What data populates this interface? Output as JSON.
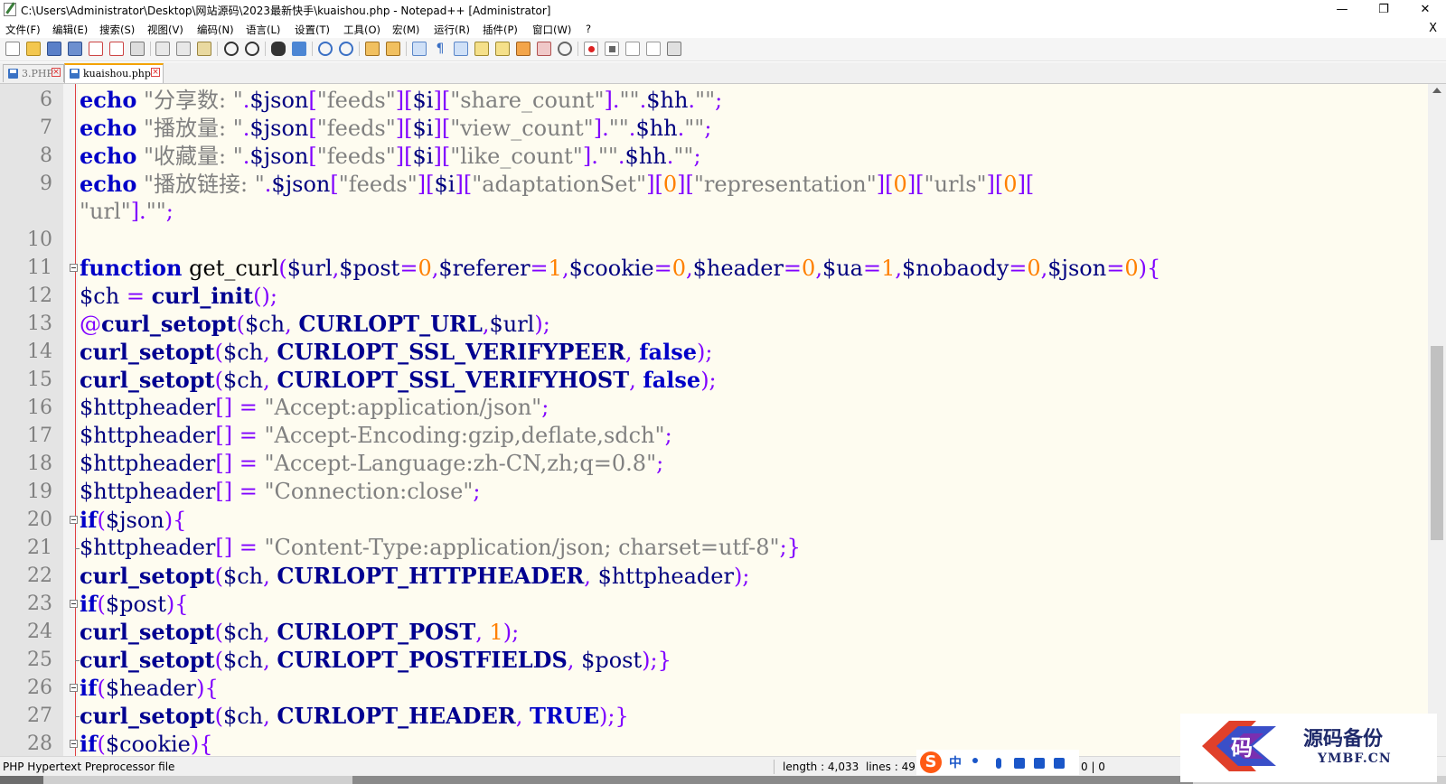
{
  "window": {
    "title": "C:\\Users\\Administrator\\Desktop\\网站源码\\2023最新快手\\kuaishou.php - Notepad++ [Administrator]",
    "minimize": "—",
    "restore": "❐",
    "close": "✕"
  },
  "menu": {
    "items": [
      "文件(F)",
      "编辑(E)",
      "搜索(S)",
      "视图(V)",
      "编码(N)",
      "语言(L)",
      "设置(T)",
      "工具(O)",
      "宏(M)",
      "运行(R)",
      "插件(P)",
      "窗口(W)",
      "?"
    ],
    "close_doc": "X"
  },
  "tabs": [
    {
      "label": "3.PHP",
      "active": false
    },
    {
      "label": "kuaishou.php",
      "active": true
    }
  ],
  "editor": {
    "lines": [
      {
        "n": "6",
        "html": "<span class=\"kw\">echo</span> <span class=\"str\">\"分享数: \"</span><span class=\"op\">.</span><span class=\"var\">$json</span><span class=\"op\">[</span><span class=\"str\">\"feeds\"</span><span class=\"op\">][</span><span class=\"var\">$i</span><span class=\"op\">][</span><span class=\"str\">\"share_count\"</span><span class=\"op\">].</span><span class=\"str\">\"\"</span><span class=\"op\">.</span><span class=\"var\">$hh</span><span class=\"op\">.</span><span class=\"str\">\"\"</span><span class=\"op\">;</span>"
      },
      {
        "n": "7",
        "html": "<span class=\"kw\">echo</span> <span class=\"str\">\"播放量: \"</span><span class=\"op\">.</span><span class=\"var\">$json</span><span class=\"op\">[</span><span class=\"str\">\"feeds\"</span><span class=\"op\">][</span><span class=\"var\">$i</span><span class=\"op\">][</span><span class=\"str\">\"view_count\"</span><span class=\"op\">].</span><span class=\"str\">\"\"</span><span class=\"op\">.</span><span class=\"var\">$hh</span><span class=\"op\">.</span><span class=\"str\">\"\"</span><span class=\"op\">;</span>"
      },
      {
        "n": "8",
        "html": "<span class=\"kw\">echo</span> <span class=\"str\">\"收藏量: \"</span><span class=\"op\">.</span><span class=\"var\">$json</span><span class=\"op\">[</span><span class=\"str\">\"feeds\"</span><span class=\"op\">][</span><span class=\"var\">$i</span><span class=\"op\">][</span><span class=\"str\">\"like_count\"</span><span class=\"op\">].</span><span class=\"str\">\"\"</span><span class=\"op\">.</span><span class=\"var\">$hh</span><span class=\"op\">.</span><span class=\"str\">\"\"</span><span class=\"op\">;</span>"
      },
      {
        "n": "9",
        "html": "<span class=\"kw\">echo</span> <span class=\"str\">\"播放链接: \"</span><span class=\"op\">.</span><span class=\"var\">$json</span><span class=\"op\">[</span><span class=\"str\">\"feeds\"</span><span class=\"op\">][</span><span class=\"var\">$i</span><span class=\"op\">][</span><span class=\"str\">\"adaptationSet\"</span><span class=\"op\">][</span><span class=\"num\">0</span><span class=\"op\">][</span><span class=\"str\">\"representation\"</span><span class=\"op\">][</span><span class=\"num\">0</span><span class=\"op\">][</span><span class=\"str\">\"urls\"</span><span class=\"op\">][</span><span class=\"num\">0</span><span class=\"op\">][</span>"
      },
      {
        "n": "",
        "html": "<span class=\"str\">\"url\"</span><span class=\"op\">].</span><span class=\"str\">\"\"</span><span class=\"op\">;</span>"
      },
      {
        "n": "10",
        "html": ""
      },
      {
        "n": "11",
        "fold": true,
        "html": "<span class=\"kw\">function</span> get_curl<span class=\"op\">(</span><span class=\"var\">$url</span><span class=\"op\">,</span><span class=\"var\">$post</span><span class=\"op\">=</span><span class=\"num\">0</span><span class=\"op\">,</span><span class=\"var\">$referer</span><span class=\"op\">=</span><span class=\"num\">1</span><span class=\"op\">,</span><span class=\"var\">$cookie</span><span class=\"op\">=</span><span class=\"num\">0</span><span class=\"op\">,</span><span class=\"var\">$header</span><span class=\"op\">=</span><span class=\"num\">0</span><span class=\"op\">,</span><span class=\"var\">$ua</span><span class=\"op\">=</span><span class=\"num\">1</span><span class=\"op\">,</span><span class=\"var\">$nobaody</span><span class=\"op\">=</span><span class=\"num\">0</span><span class=\"op\">,</span><span class=\"var\">$json</span><span class=\"op\">=</span><span class=\"num\">0</span><span class=\"op\">){</span>"
      },
      {
        "n": "12",
        "html": "<span class=\"var\">$ch</span> <span class=\"op\">=</span> <span class=\"fn\">curl_init</span><span class=\"op\">();</span>"
      },
      {
        "n": "13",
        "html": "<span class=\"op\">@</span><span class=\"fn\">curl_setopt</span><span class=\"op\">(</span><span class=\"var\">$ch</span><span class=\"op\">,</span> <span class=\"cn\">CURLOPT_URL</span><span class=\"op\">,</span><span class=\"var\">$url</span><span class=\"op\">);</span>"
      },
      {
        "n": "14",
        "html": "<span class=\"fn\">curl_setopt</span><span class=\"op\">(</span><span class=\"var\">$ch</span><span class=\"op\">,</span> <span class=\"cn\">CURLOPT_SSL_VERIFYPEER</span><span class=\"op\">,</span> <span class=\"kw\">false</span><span class=\"op\">);</span>"
      },
      {
        "n": "15",
        "html": "<span class=\"fn\">curl_setopt</span><span class=\"op\">(</span><span class=\"var\">$ch</span><span class=\"op\">,</span> <span class=\"cn\">CURLOPT_SSL_VERIFYHOST</span><span class=\"op\">,</span> <span class=\"kw\">false</span><span class=\"op\">);</span>"
      },
      {
        "n": "16",
        "html": "<span class=\"var\">$httpheader</span><span class=\"op\">[]</span> <span class=\"op\">=</span> <span class=\"str\">\"Accept:application/json\"</span><span class=\"op\">;</span>"
      },
      {
        "n": "17",
        "html": "<span class=\"var\">$httpheader</span><span class=\"op\">[]</span> <span class=\"op\">=</span> <span class=\"str\">\"Accept-Encoding:gzip,deflate,sdch\"</span><span class=\"op\">;</span>"
      },
      {
        "n": "18",
        "html": "<span class=\"var\">$httpheader</span><span class=\"op\">[]</span> <span class=\"op\">=</span> <span class=\"str\">\"Accept-Language:zh-CN,zh;q=0.8\"</span><span class=\"op\">;</span>"
      },
      {
        "n": "19",
        "html": "<span class=\"var\">$httpheader</span><span class=\"op\">[]</span> <span class=\"op\">=</span> <span class=\"str\">\"Connection:close\"</span><span class=\"op\">;</span>"
      },
      {
        "n": "20",
        "fold": true,
        "html": "<span class=\"kw\">if</span><span class=\"op\">(</span><span class=\"var\">$json</span><span class=\"op\">){</span>"
      },
      {
        "n": "21",
        "tick": true,
        "html": "<span class=\"var\">$httpheader</span><span class=\"op\">[]</span> <span class=\"op\">=</span> <span class=\"str\">\"Content-Type:application/json; charset=utf-8\"</span><span class=\"op\">;}</span>"
      },
      {
        "n": "22",
        "html": "<span class=\"fn\">curl_setopt</span><span class=\"op\">(</span><span class=\"var\">$ch</span><span class=\"op\">,</span> <span class=\"cn\">CURLOPT_HTTPHEADER</span><span class=\"op\">,</span> <span class=\"var\">$httpheader</span><span class=\"op\">);</span>"
      },
      {
        "n": "23",
        "fold": true,
        "html": "<span class=\"kw\">if</span><span class=\"op\">(</span><span class=\"var\">$post</span><span class=\"op\">){</span>"
      },
      {
        "n": "24",
        "html": "<span class=\"fn\">curl_setopt</span><span class=\"op\">(</span><span class=\"var\">$ch</span><span class=\"op\">,</span> <span class=\"cn\">CURLOPT_POST</span><span class=\"op\">,</span> <span class=\"num\">1</span><span class=\"op\">);</span>"
      },
      {
        "n": "25",
        "tick": true,
        "html": "<span class=\"fn\">curl_setopt</span><span class=\"op\">(</span><span class=\"var\">$ch</span><span class=\"op\">,</span> <span class=\"cn\">CURLOPT_POSTFIELDS</span><span class=\"op\">,</span> <span class=\"var\">$post</span><span class=\"op\">);}</span>"
      },
      {
        "n": "26",
        "fold": true,
        "html": "<span class=\"kw\">if</span><span class=\"op\">(</span><span class=\"var\">$header</span><span class=\"op\">){</span>"
      },
      {
        "n": "27",
        "tick": true,
        "html": "<span class=\"fn\">curl_setopt</span><span class=\"op\">(</span><span class=\"var\">$ch</span><span class=\"op\">,</span> <span class=\"cn\">CURLOPT_HEADER</span><span class=\"op\">,</span> <span class=\"kw\">TRUE</span><span class=\"op\">);}</span>"
      },
      {
        "n": "28",
        "fold": true,
        "html": "<span class=\"kw\">if</span><span class=\"op\">(</span><span class=\"var\">$cookie</span><span class=\"op\">){</span>"
      }
    ]
  },
  "status": {
    "file_type": "PHP Hypertext Preprocessor file",
    "length": "length : 4,033",
    "lines": "lines : 49",
    "position": "0 | 0"
  },
  "ime": {
    "logo": "S",
    "mode": "中"
  },
  "watermark": {
    "title": "源码备份",
    "sub": "YMBF.CN",
    "badge": "码"
  },
  "colors": {
    "keyword": "#0000c8",
    "string": "#808080",
    "number": "#ff8000",
    "operator": "#8000ff",
    "editor_bg": "#fefcf0",
    "tab_accent": "#f4a300"
  }
}
